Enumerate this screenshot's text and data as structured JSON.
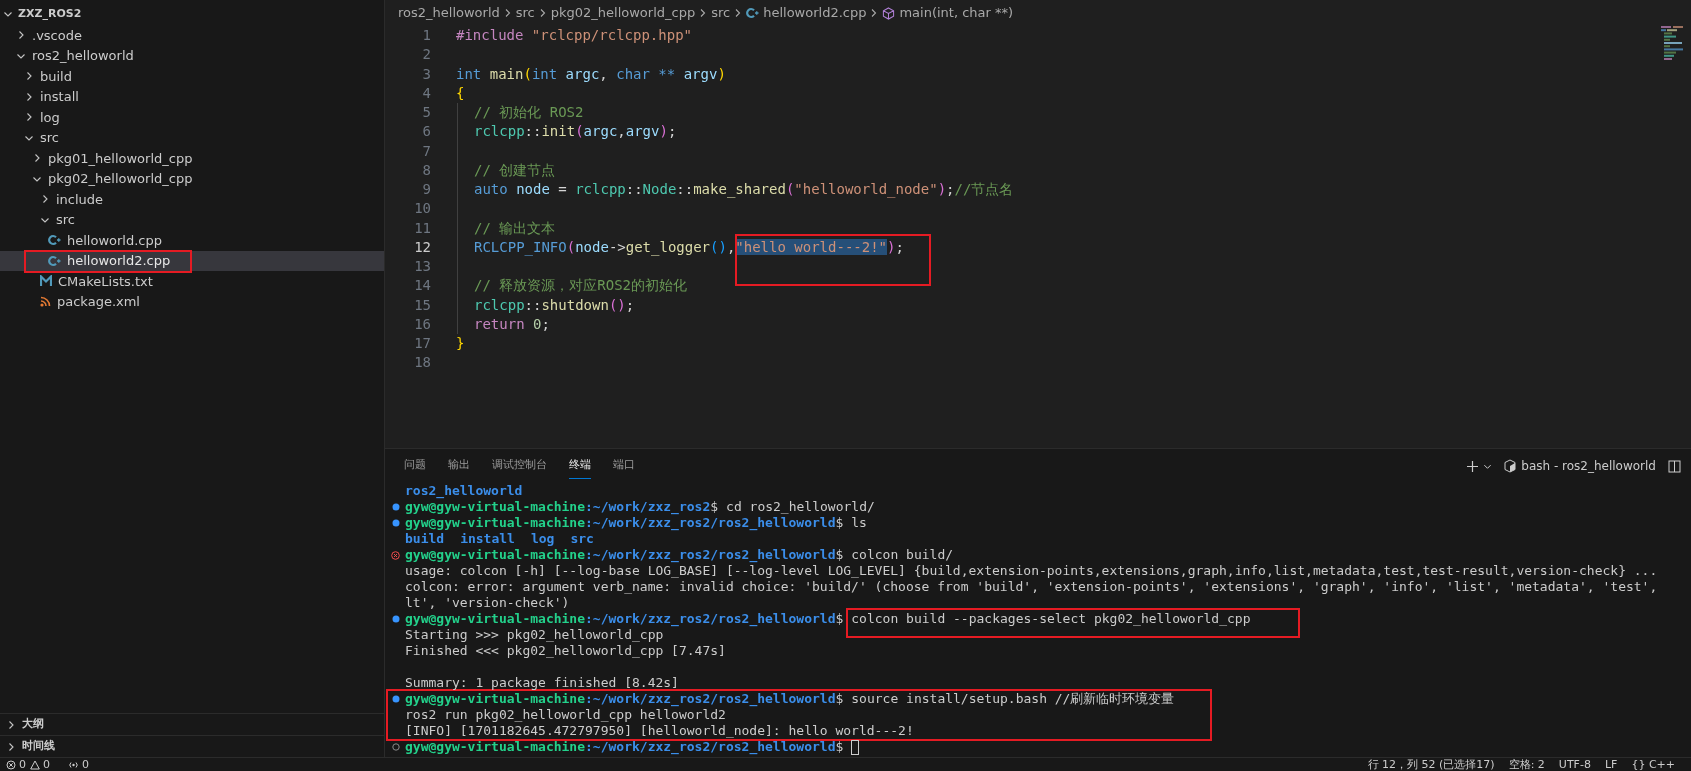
{
  "explorer": {
    "title": "ZXZ_ROS2",
    "expanded": true,
    "tree": [
      {
        "label": ".vscode",
        "kind": "folder",
        "expanded": false,
        "selected": false,
        "boxed": false
      },
      {
        "label": "ros2_helloworld",
        "kind": "folder",
        "expanded": true,
        "selected": false,
        "boxed": false,
        "children": [
          {
            "label": "build",
            "kind": "folder",
            "expanded": false,
            "selected": false,
            "boxed": false
          },
          {
            "label": "install",
            "kind": "folder",
            "expanded": false,
            "selected": false,
            "boxed": false
          },
          {
            "label": "log",
            "kind": "folder",
            "expanded": false,
            "selected": false,
            "boxed": false
          },
          {
            "label": "src",
            "kind": "folder",
            "expanded": true,
            "selected": false,
            "boxed": false,
            "children": [
              {
                "label": "pkg01_helloworld_cpp",
                "kind": "folder",
                "expanded": false,
                "selected": false,
                "boxed": false
              },
              {
                "label": "pkg02_helloworld_cpp",
                "kind": "folder",
                "expanded": true,
                "selected": false,
                "boxed": false,
                "children": [
                  {
                    "label": "include",
                    "kind": "folder",
                    "expanded": false,
                    "selected": false,
                    "boxed": false
                  },
                  {
                    "label": "src",
                    "kind": "folder",
                    "expanded": true,
                    "selected": false,
                    "boxed": false,
                    "children": [
                      {
                        "label": "helloworld.cpp",
                        "kind": "cpp",
                        "selected": false,
                        "boxed": false
                      },
                      {
                        "label": "helloworld2.cpp",
                        "kind": "cpp",
                        "selected": true,
                        "boxed": true
                      }
                    ]
                  },
                  {
                    "label": "CMakeLists.txt",
                    "kind": "cmake",
                    "selected": false,
                    "boxed": false
                  },
                  {
                    "label": "package.xml",
                    "kind": "xml",
                    "selected": false,
                    "boxed": false
                  }
                ]
              }
            ]
          }
        ]
      }
    ],
    "sections": [
      {
        "label": "大纲",
        "expanded": false
      },
      {
        "label": "时间线",
        "expanded": false
      }
    ]
  },
  "breadcrumbs": [
    {
      "text": "ros2_helloworld",
      "kind": "folder"
    },
    {
      "text": "src",
      "kind": "folder"
    },
    {
      "text": "pkg02_helloworld_cpp",
      "kind": "folder"
    },
    {
      "text": "src",
      "kind": "folder"
    },
    {
      "text": "helloworld2.cpp",
      "kind": "cpp"
    },
    {
      "text": "main(int, char **)",
      "kind": "symbol"
    }
  ],
  "code": [
    {
      "number": "1",
      "current": false,
      "indented": false,
      "tokens": [
        {
          "text": "#include",
          "kind": "control"
        },
        {
          "text": " \"rclcpp/rclcpp.hpp\"",
          "kind": "string"
        }
      ]
    },
    {
      "number": "2",
      "current": false,
      "indented": false
    },
    {
      "number": "3",
      "current": false,
      "indented": false,
      "tokens": [
        {
          "text": "int",
          "kind": "type"
        },
        {
          "text": " main",
          "kind": "function"
        },
        {
          "text": "(",
          "kind": "bracket1"
        },
        {
          "text": "int",
          "kind": "type"
        },
        {
          "text": " argc",
          "kind": "variable"
        },
        {
          "text": ", ",
          "kind": "plain"
        },
        {
          "text": "char",
          "kind": "type"
        },
        {
          "text": " **",
          "kind": "type"
        },
        {
          "text": " argv",
          "kind": "variable"
        },
        {
          "text": ")",
          "kind": "bracket1"
        }
      ]
    },
    {
      "number": "4",
      "current": false,
      "indented": false,
      "tokens": [
        {
          "text": "{",
          "kind": "bracket1"
        }
      ]
    },
    {
      "number": "5",
      "current": false,
      "indented": true,
      "tokens": [
        {
          "text": "// 初始化 ROS2",
          "kind": "comment"
        }
      ]
    },
    {
      "number": "6",
      "current": false,
      "indented": true,
      "tokens": [
        {
          "text": "rclcpp",
          "kind": "namespace"
        },
        {
          "text": "::",
          "kind": "plain"
        },
        {
          "text": "init",
          "kind": "function"
        },
        {
          "text": "(",
          "kind": "bracket2"
        },
        {
          "text": "argc",
          "kind": "variable"
        },
        {
          "text": ",",
          "kind": "plain"
        },
        {
          "text": "argv",
          "kind": "variable"
        },
        {
          "text": ")",
          "kind": "bracket2"
        },
        {
          "text": ";",
          "kind": "plain"
        }
      ]
    },
    {
      "number": "7",
      "current": false,
      "indented": true
    },
    {
      "number": "8",
      "current": false,
      "indented": true,
      "tokens": [
        {
          "text": "// 创建节点",
          "kind": "comment"
        }
      ]
    },
    {
      "number": "9",
      "current": false,
      "indented": true,
      "tokens": [
        {
          "text": "auto",
          "kind": "type"
        },
        {
          "text": " node",
          "kind": "variable"
        },
        {
          "text": " = ",
          "kind": "plain"
        },
        {
          "text": "rclcpp",
          "kind": "namespace"
        },
        {
          "text": "::",
          "kind": "plain"
        },
        {
          "text": "Node",
          "kind": "namespace"
        },
        {
          "text": "::",
          "kind": "plain"
        },
        {
          "text": "make_shared",
          "kind": "function"
        },
        {
          "text": "(",
          "kind": "bracket2"
        },
        {
          "text": "\"helloworld_node\"",
          "kind": "string"
        },
        {
          "text": ")",
          "kind": "bracket2"
        },
        {
          "text": ";",
          "kind": "plain"
        },
        {
          "text": "//节点名",
          "kind": "comment"
        }
      ]
    },
    {
      "number": "10",
      "current": false,
      "indented": true
    },
    {
      "number": "11",
      "current": false,
      "indented": true,
      "tokens": [
        {
          "text": "// 输出文本",
          "kind": "comment"
        }
      ]
    },
    {
      "number": "12",
      "current": true,
      "indented": true,
      "tokens": [
        {
          "text": "RCLCPP_INFO",
          "kind": "macro"
        },
        {
          "text": "(",
          "kind": "bracket2"
        },
        {
          "text": "node",
          "kind": "variable"
        },
        {
          "text": "->",
          "kind": "plain"
        },
        {
          "text": "get_logger",
          "kind": "function"
        },
        {
          "text": "()",
          "kind": "bracket3"
        },
        {
          "text": ",",
          "kind": "plain"
        },
        {
          "text": "\"hello world---2!\"",
          "kind": "string",
          "selected": true,
          "boxed": true
        },
        {
          "text": ")",
          "kind": "bracket2"
        },
        {
          "text": ";",
          "kind": "plain"
        }
      ]
    },
    {
      "number": "13",
      "current": false,
      "indented": true
    },
    {
      "number": "14",
      "current": false,
      "indented": true,
      "tokens": [
        {
          "text": "// 释放资源，对应ROS2的初始化",
          "kind": "comment"
        }
      ]
    },
    {
      "number": "15",
      "current": false,
      "indented": true,
      "tokens": [
        {
          "text": "rclcpp",
          "kind": "namespace"
        },
        {
          "text": "::",
          "kind": "plain"
        },
        {
          "text": "shutdown",
          "kind": "function"
        },
        {
          "text": "()",
          "kind": "bracket2"
        },
        {
          "text": ";",
          "kind": "plain"
        }
      ]
    },
    {
      "number": "16",
      "current": false,
      "indented": true,
      "tokens": [
        {
          "text": "return",
          "kind": "control"
        },
        {
          "text": " 0",
          "kind": "number"
        },
        {
          "text": ";",
          "kind": "plain"
        }
      ]
    },
    {
      "number": "17",
      "current": false,
      "indented": false,
      "tokens": [
        {
          "text": "}",
          "kind": "bracket1"
        }
      ]
    },
    {
      "number": "18",
      "current": false,
      "indented": false
    }
  ],
  "panel": {
    "tabs": [
      {
        "label": "问题",
        "selected": false
      },
      {
        "label": "输出",
        "selected": false
      },
      {
        "label": "调试控制台",
        "selected": false
      },
      {
        "label": "终端",
        "selected": true
      },
      {
        "label": "端口",
        "selected": false
      }
    ],
    "terminal_name": "bash - ros2_helloworld",
    "lines": [
      {
        "kind": "dirs",
        "boxed": false,
        "items": [
          "ros2_helloworld"
        ]
      },
      {
        "kind": "prompt",
        "marker": {
          "kind": "success"
        },
        "boxed": false,
        "user": "gyw@gyw-virtual-machine",
        "path": ":~/work/zxz_ros2",
        "symbol": "$",
        "command": "cd ros2_helloworld/",
        "command_boxed": false
      },
      {
        "kind": "prompt",
        "marker": {
          "kind": "success"
        },
        "boxed": false,
        "user": "gyw@gyw-virtual-machine",
        "path": ":~/work/zxz_ros2/ros2_helloworld",
        "symbol": "$",
        "command": "ls",
        "command_boxed": false
      },
      {
        "kind": "dirs",
        "boxed": false,
        "items": [
          "build",
          "install",
          "log",
          "src"
        ]
      },
      {
        "kind": "prompt",
        "marker": {
          "kind": "error"
        },
        "boxed": false,
        "user": "gyw@gyw-virtual-machine",
        "path": ":~/work/zxz_ros2/ros2_helloworld",
        "symbol": "$",
        "command": "colcon build/",
        "command_boxed": false
      },
      {
        "kind": "output",
        "boxed": false,
        "text": "usage: colcon [-h] [--log-base LOG_BASE] [--log-level LOG_LEVEL] {build,extension-points,extensions,graph,info,list,metadata,test,test-result,version-check} ..."
      },
      {
        "kind": "output",
        "boxed": false,
        "text": "colcon: error: argument verb_name: invalid choice: 'build/' (choose from 'build', 'extension-points', 'extensions', 'graph', 'info', 'list', 'metadata', 'test',"
      },
      {
        "kind": "output",
        "boxed": false,
        "text": "lt', 'version-check')"
      },
      {
        "kind": "prompt",
        "marker": {
          "kind": "success"
        },
        "boxed": false,
        "user": "gyw@gyw-virtual-machine",
        "path": ":~/work/zxz_ros2/ros2_helloworld",
        "symbol": "$",
        "command": "colcon build --packages-select pkg02_helloworld_cpp",
        "command_boxed": true
      },
      {
        "kind": "output",
        "boxed": false,
        "text": "Starting >>> pkg02_helloworld_cpp"
      },
      {
        "kind": "output",
        "boxed": false,
        "text": "Finished <<< pkg02_helloworld_cpp [7.47s]"
      },
      {
        "kind": "blank",
        "boxed": false
      },
      {
        "kind": "output",
        "boxed": false,
        "text": "Summary: 1 package finished [8.42s]"
      },
      {
        "kind": "prompt",
        "marker": {
          "kind": "success"
        },
        "boxed": true,
        "user": "gyw@gyw-virtual-machine",
        "path": ":~/work/zxz_ros2/ros2_helloworld",
        "symbol": "$",
        "command": "source install/setup.bash //刷新临时环境变量",
        "command_boxed": false
      },
      {
        "kind": "output",
        "boxed": true,
        "text": "ros2 run pkg02_helloworld_cpp helloworld2"
      },
      {
        "kind": "output",
        "boxed": true,
        "text": "[INFO] [1701182645.472797950] [helloworld_node]: hello world---2!"
      },
      {
        "kind": "prompt",
        "marker": {
          "kind": "pending"
        },
        "boxed": false,
        "user": "gyw@gyw-virtual-machine",
        "path": ":~/work/zxz_ros2/ros2_helloworld",
        "symbol": "$",
        "cursor": true,
        "command_boxed": false
      }
    ]
  },
  "status_bar": {
    "left": [
      {
        "kind": "errors",
        "text": "0"
      },
      {
        "kind": "warnings",
        "text": "0"
      },
      {
        "kind": "ports",
        "text": "0"
      }
    ],
    "right": [
      "行 12，列 52 (已选择17)",
      "空格: 2",
      "UTF-8",
      "LF",
      "{} C++"
    ]
  }
}
